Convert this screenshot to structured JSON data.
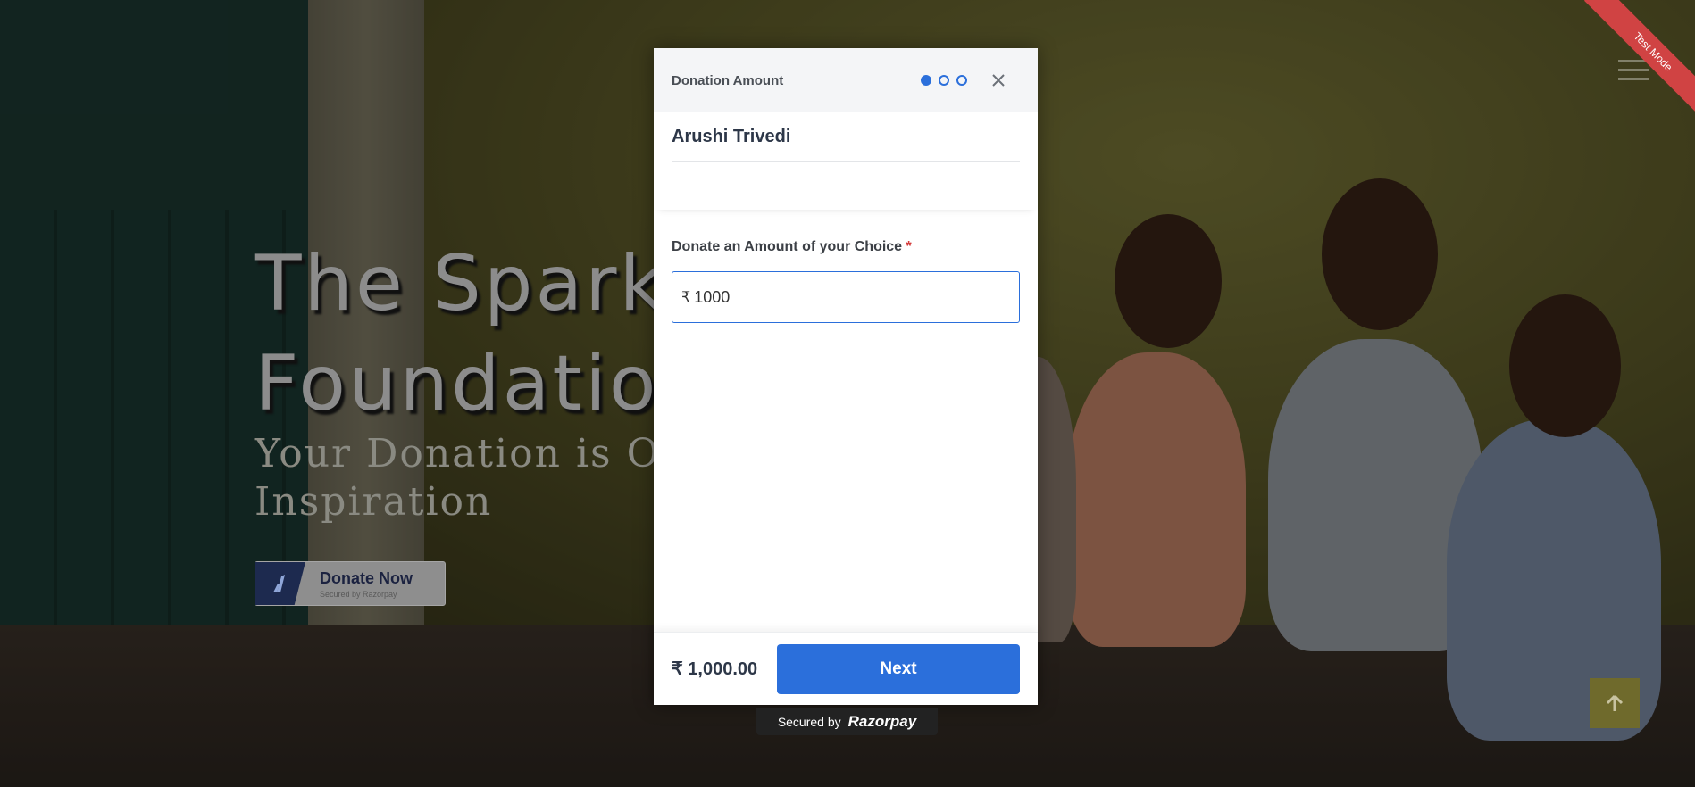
{
  "hero": {
    "title_line1": "The Spark",
    "title_line2": "Foundatio",
    "subtitle_line1": "Your Donation is Ot",
    "subtitle_line2": "Inspiration",
    "donate_button": {
      "label": "Donate Now",
      "sublabel": "Secured by Razorpay"
    },
    "ribbon": "Test Mode"
  },
  "modal": {
    "title": "Donation Amount",
    "steps": {
      "total": 3,
      "current": 1
    },
    "merchant_name": "Arushi Trivedi",
    "amount_field": {
      "label": "Donate an Amount of your Choice",
      "required_marker": "*",
      "currency_symbol": "₹",
      "value": "1000"
    },
    "footer": {
      "total": "₹ 1,000.00",
      "next_label": "Next"
    },
    "secured": {
      "prefix": "Secured by",
      "brand": "Razorpay"
    }
  },
  "colors": {
    "accent": "#2b6fdb",
    "ribbon": "#d04343",
    "required": "#d43c3c"
  },
  "icons": [
    "close-icon",
    "menu-icon",
    "arrow-up-icon",
    "razorpay-logo-icon"
  ]
}
